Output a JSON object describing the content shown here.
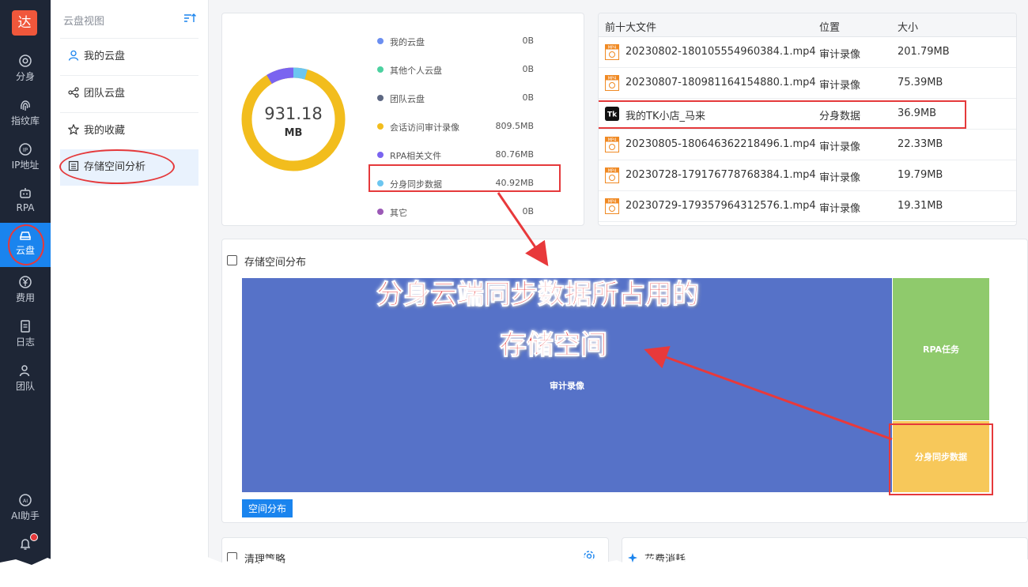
{
  "rail": {
    "logo": "达",
    "items": [
      {
        "label": "分身",
        "icon": "chrome-icon"
      },
      {
        "label": "指纹库",
        "icon": "fingerprint-icon"
      },
      {
        "label": "IP地址",
        "icon": "ip-icon"
      },
      {
        "label": "RPA",
        "icon": "robot-icon"
      },
      {
        "label": "云盘",
        "icon": "cloud-drive-icon"
      },
      {
        "label": "费用",
        "icon": "yen-icon"
      },
      {
        "label": "日志",
        "icon": "document-icon"
      },
      {
        "label": "团队",
        "icon": "team-icon"
      }
    ],
    "ai": "AI助手",
    "bell": "通知"
  },
  "sidebar": {
    "title": "云盘视图",
    "items": [
      {
        "label": "我的云盘",
        "icon": "user-icon"
      },
      {
        "label": "团队云盘",
        "icon": "share-icon"
      },
      {
        "label": "我的收藏",
        "icon": "star-icon"
      },
      {
        "label": "存储空间分析",
        "icon": "list-icon"
      }
    ]
  },
  "usage": {
    "total": "931.18",
    "unit": "MB",
    "legend": [
      {
        "label": "我的云盘",
        "value": "0B",
        "color": "#6b8ef0"
      },
      {
        "label": "其他个人云盘",
        "value": "0B",
        "color": "#4cd1a0"
      },
      {
        "label": "团队云盘",
        "value": "0B",
        "color": "#5d6782"
      },
      {
        "label": "会话访问审计录像",
        "value": "809.5MB",
        "color": "#f2bd1d"
      },
      {
        "label": "RPA相关文件",
        "value": "80.76MB",
        "color": "#7a64f0"
      },
      {
        "label": "分身同步数据",
        "value": "40.92MB",
        "color": "#6cc6f0"
      },
      {
        "label": "其它",
        "value": "0B",
        "color": "#9b59b6"
      }
    ]
  },
  "top_files": {
    "headers": [
      "前十大文件",
      "位置",
      "大小"
    ],
    "rows": [
      {
        "name": "20230802-180105554960384.1.mp4",
        "location": "审计录像",
        "size": "201.79MB",
        "icon": "mp4-icon"
      },
      {
        "name": "20230807-180981164154880.1.mp4",
        "location": "审计录像",
        "size": "75.39MB",
        "icon": "mp4-icon"
      },
      {
        "name": "我的TK小店_马来",
        "location": "分身数据",
        "size": "36.9MB",
        "icon": "tiktok-icon"
      },
      {
        "name": "20230805-180646362218496.1.mp4",
        "location": "审计录像",
        "size": "22.33MB",
        "icon": "mp4-icon"
      },
      {
        "name": "20230728-179176778768384.1.mp4",
        "location": "审计录像",
        "size": "19.79MB",
        "icon": "mp4-icon"
      },
      {
        "name": "20230729-179357964312576.1.mp4",
        "location": "审计录像",
        "size": "19.31MB",
        "icon": "mp4-icon"
      }
    ]
  },
  "distribution": {
    "title": "存储空间分布",
    "blocks": [
      {
        "label": "审计录像",
        "color": "#5672c8"
      },
      {
        "label": "RPA任务",
        "color": "#8fca6c"
      },
      {
        "label": "分身同步数据",
        "color": "#f7c85a"
      }
    ],
    "button": "空间分布"
  },
  "bottom_cards": [
    {
      "title": "清理策略"
    },
    {
      "title": "花费消耗"
    }
  ],
  "annotation": {
    "line1": "分身云端同步数据所占用的",
    "line2": "存储空间",
    "color": "#e8393b"
  }
}
